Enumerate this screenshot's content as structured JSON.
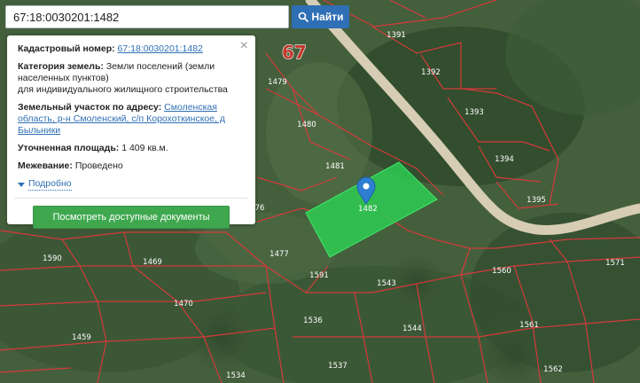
{
  "search": {
    "value": "67:18:0030201:1482",
    "button_label": "Найти"
  },
  "popup": {
    "close_symbol": "×",
    "cadastral_label": "Кадастровый номер:",
    "cadastral_value": "67:18:0030201:1482",
    "category_label": "Категория земель:",
    "category_value": "Земли поселений (земли населенных пунктов)",
    "category_use": "для индивидуального жилищного строительства",
    "address_label": "Земельный участок по адресу:",
    "address_value": "Смоленская область, р-н Смоленский, с/п Корохоткинское, д Быльники",
    "area_label": "Уточненная площадь:",
    "area_value": "1 409 кв.м.",
    "survey_label": "Межевание:",
    "survey_value": "Проведено",
    "more_label": "Подробно",
    "docs_button": "Посмотреть доступные документы"
  },
  "map": {
    "region_number": "67",
    "selected_parcel_label": "1482",
    "parcel_labels": [
      "1391",
      "1392",
      "1393",
      "1394",
      "1395",
      "1479",
      "1480",
      "1481",
      "76",
      "1477",
      "1469",
      "1590",
      "1470",
      "1591",
      "1543",
      "1560",
      "1571",
      "1536",
      "1544",
      "1561",
      "1459",
      "1537",
      "1562",
      "1534"
    ],
    "colors": {
      "boundary": "#d43a3a",
      "selected_fill": "#2ecc52",
      "marker": "#2e7fd1",
      "road": "#d6cdb4"
    }
  }
}
